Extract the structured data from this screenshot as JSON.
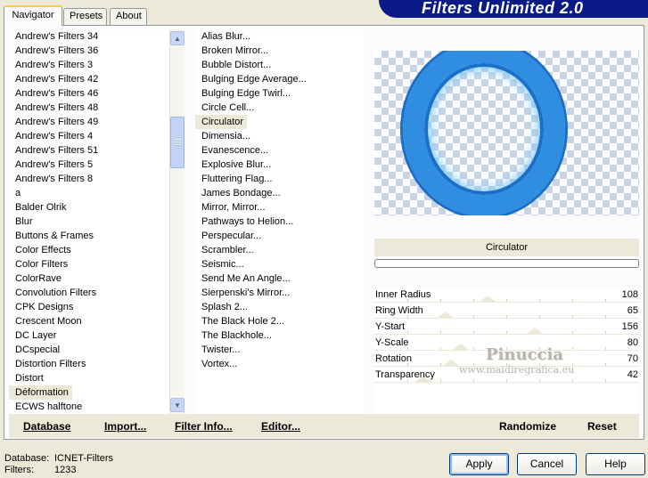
{
  "tabs": [
    {
      "label": "Navigator",
      "active": true
    },
    {
      "label": "Presets",
      "active": false
    },
    {
      "label": "About",
      "active": false
    }
  ],
  "banner": {
    "title": "Filters Unlimited 2.0"
  },
  "categories": [
    "Andrew's Filters 34",
    "Andrew's Filters 36",
    "Andrew's Filters 3",
    "Andrew's Filters 42",
    "Andrew's Filters 46",
    "Andrew's Filters 48",
    "Andrew's Filters 49",
    "Andrew's Filters 4",
    "Andrew's Filters 51",
    "Andrew's Filters 5",
    "Andrew's Filters 8",
    "a",
    "Balder Olrik",
    "Blur",
    "Buttons & Frames",
    "Color Effects",
    "Color Filters",
    "ColorRave",
    "Convolution Filters",
    "CPK Designs",
    "Crescent Moon",
    "DC Layer",
    "DCspecial",
    "Distortion Filters",
    "Distort",
    "Déformation",
    "ECWS halftone"
  ],
  "selected_category": "Déformation",
  "filters": [
    "Alias Blur...",
    "Broken Mirror...",
    "Bubble Distort...",
    "Bulging Edge Average...",
    "Bulging Edge Twirl...",
    "Circle Cell...",
    "Circulator",
    "Dimensia...",
    "Evanescence...",
    "Explosive Blur...",
    "Fluttering Flag...",
    "James Bondage...",
    "Mirror, Mirror...",
    "Pathways to Helion...",
    "Perspecular...",
    "Scrambler...",
    "Seismic...",
    "Send Me An Angle...",
    "Sierpenski's Mirror...",
    "Splash 2...",
    "The Black Hole 2...",
    "The Blackhole...",
    "Twister...",
    "Vortex..."
  ],
  "selected_filter": "Circulator",
  "preview": {
    "filter_name": "Circulator",
    "ring_color": "#2f8ee0"
  },
  "params": [
    {
      "label": "Inner Radius",
      "value": "108",
      "level": 108
    },
    {
      "label": "Ring Width",
      "value": "65",
      "level": 65
    },
    {
      "label": "Y-Start",
      "value": "156",
      "level": 156
    },
    {
      "label": "Y-Scale",
      "value": "80",
      "level": 80
    },
    {
      "label": "Rotation",
      "value": "70",
      "level": 70
    },
    {
      "label": "Transparency",
      "value": "42",
      "level": 42
    }
  ],
  "watermark": {
    "name": "Pinuccia",
    "url": "www.maidiregrafica.eu"
  },
  "bottom_buttons": {
    "database": "Database",
    "import": "Import...",
    "filter_info": "Filter Info...",
    "editor": "Editor...",
    "randomize": "Randomize",
    "reset": "Reset"
  },
  "status": {
    "database_label": "Database:",
    "database_value": "ICNET-Filters",
    "filters_label": "Filters:",
    "filters_value": "1233"
  },
  "dialog_buttons": {
    "apply": "Apply",
    "cancel": "Cancel",
    "help": "Help"
  }
}
